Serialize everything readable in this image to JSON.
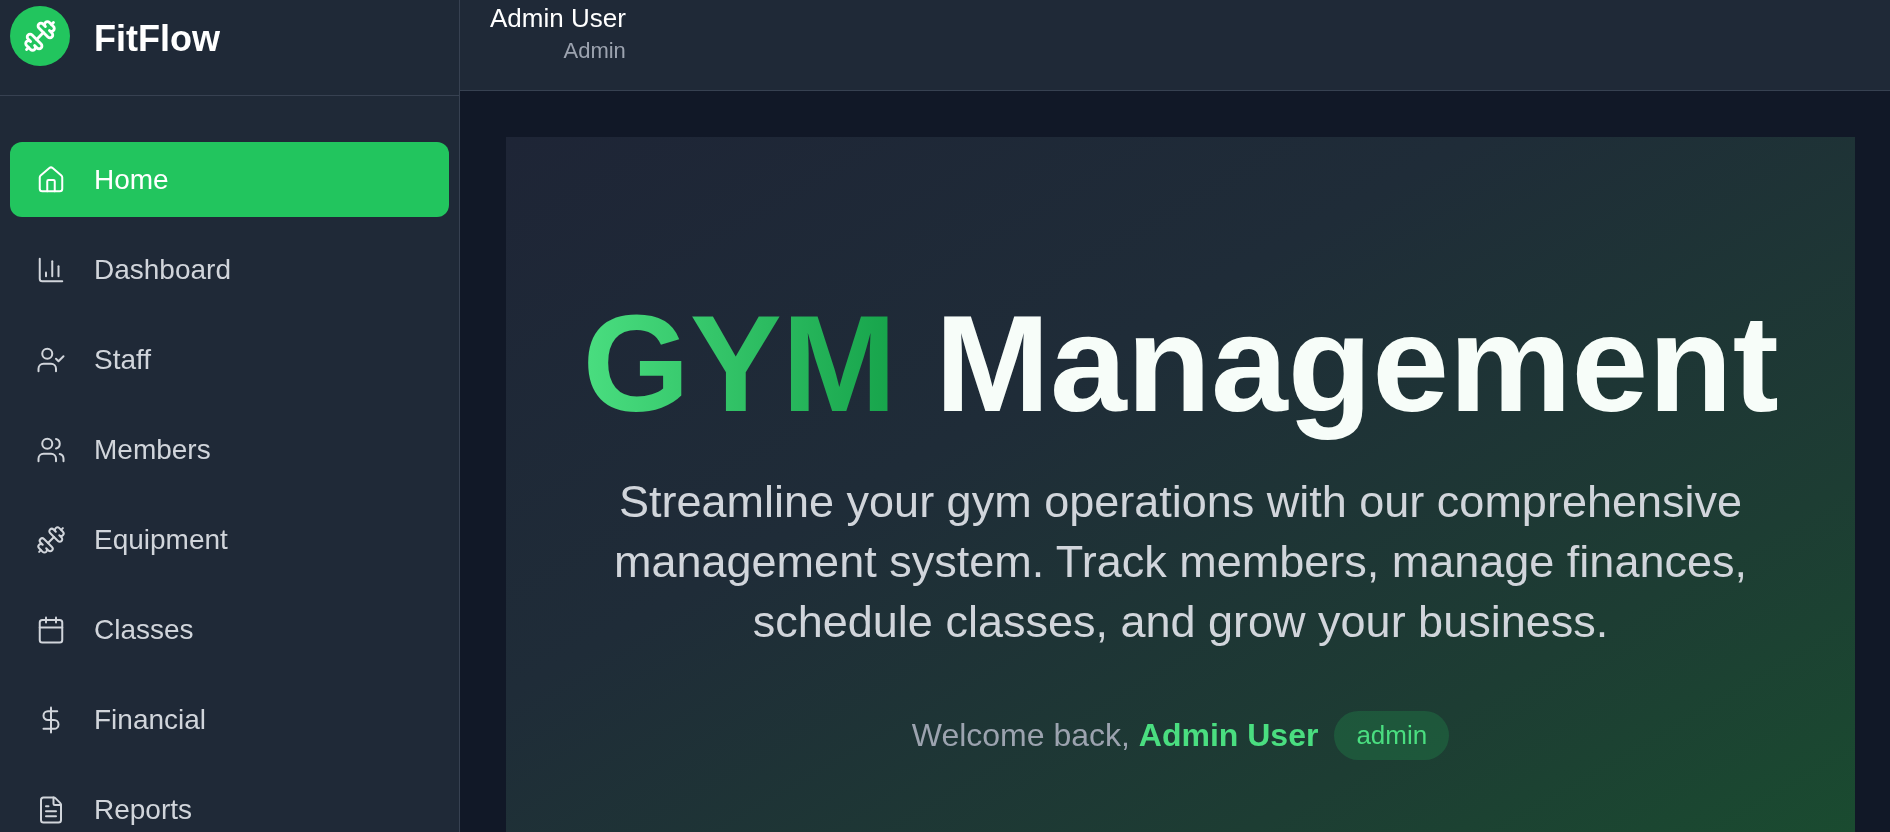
{
  "brand": {
    "name": "FitFlow"
  },
  "nav": [
    {
      "label": "Home",
      "selected": true
    },
    {
      "label": "Dashboard",
      "selected": false
    },
    {
      "label": "Staff",
      "selected": false
    },
    {
      "label": "Members",
      "selected": false
    },
    {
      "label": "Equipment",
      "selected": false
    },
    {
      "label": "Classes",
      "selected": false
    },
    {
      "label": "Financial",
      "selected": false
    },
    {
      "label": "Reports",
      "selected": false
    }
  ],
  "header": {
    "user_name": "Admin User",
    "user_role": "Admin"
  },
  "hero": {
    "title_highlight": "GYM",
    "title_rest": "Management",
    "subtitle": "Streamline your gym operations with our comprehensive management system. Track members, manage finances, schedule classes, and grow your business.",
    "welcome": "Welcome back, **Admin User**",
    "role_badge": "admin"
  }
}
